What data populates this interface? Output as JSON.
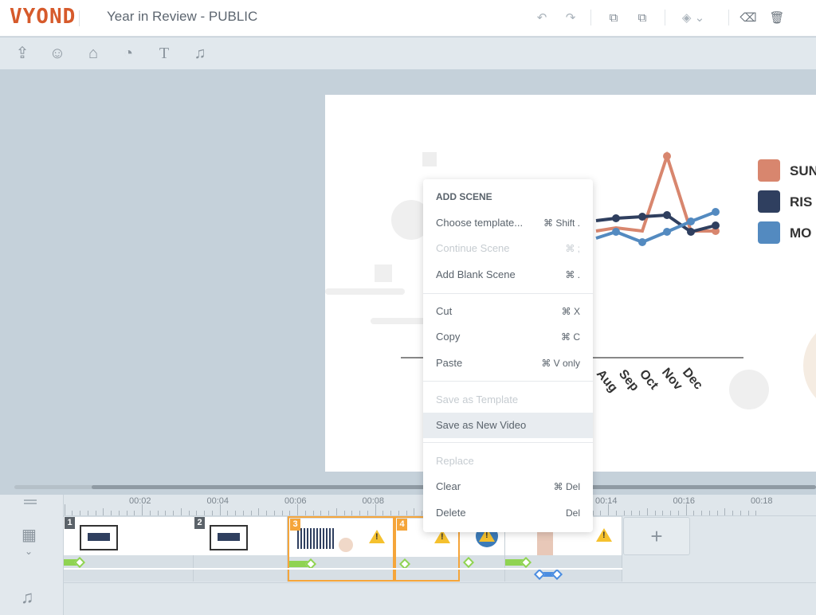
{
  "header": {
    "logo": "VYOND",
    "title": "Year in Review - PUBLIC",
    "icons": [
      "undo-icon",
      "redo-icon",
      "duplicate-icon",
      "export-icon",
      "layers-icon",
      "clear-brush-icon",
      "trash-icon"
    ]
  },
  "toolbar": {
    "icons": [
      "upload-icon",
      "character-icon",
      "prop-icon",
      "chart-icon",
      "text-icon",
      "music-icon"
    ]
  },
  "stage": {
    "legend": [
      {
        "label": "SUN",
        "color": "#d8866e"
      },
      {
        "label": "RIS",
        "color": "#2f3f5f"
      },
      {
        "label": "MO",
        "color": "#538ac0"
      }
    ],
    "months": [
      "Aug",
      "Sep",
      "Oct",
      "Nov",
      "Dec"
    ]
  },
  "context_menu": {
    "header": "ADD SCENE",
    "items": [
      {
        "label": "Choose template...",
        "shortcut": "⌘ Shift .",
        "disabled": false
      },
      {
        "label": "Continue Scene",
        "shortcut": "⌘ ;",
        "disabled": true
      },
      {
        "label": "Add Blank Scene",
        "shortcut": "⌘ .",
        "disabled": false
      },
      {
        "label": "Cut",
        "shortcut": "⌘ X",
        "disabled": false
      },
      {
        "label": "Copy",
        "shortcut": "⌘ C",
        "disabled": false
      },
      {
        "label": "Paste",
        "shortcut": "⌘ V only",
        "disabled": false
      },
      {
        "label": "Save as Template",
        "shortcut": "",
        "disabled": true
      },
      {
        "label": "Save as New Video",
        "shortcut": "",
        "disabled": false,
        "highlighted": true
      },
      {
        "label": "Replace",
        "shortcut": "",
        "disabled": true
      },
      {
        "label": "Clear",
        "shortcut": "⌘ Del",
        "disabled": false
      },
      {
        "label": "Delete",
        "shortcut": "Del",
        "disabled": false
      }
    ]
  },
  "timeline": {
    "ticks": [
      "00:02",
      "00:04",
      "00:06",
      "00:08",
      "00:10",
      "00:12",
      "00:14",
      "00:16",
      "00:18"
    ],
    "scenes": [
      {
        "number": "1"
      },
      {
        "number": "2"
      },
      {
        "number": "3",
        "selected": true
      },
      {
        "number": "4",
        "selected": true
      }
    ],
    "add_scene": "+",
    "warning": "!"
  },
  "colors": {
    "accent": "#d65a2b",
    "selection": "#f5a53a",
    "warning": "#f5c12e",
    "transition": "#8fd352"
  }
}
